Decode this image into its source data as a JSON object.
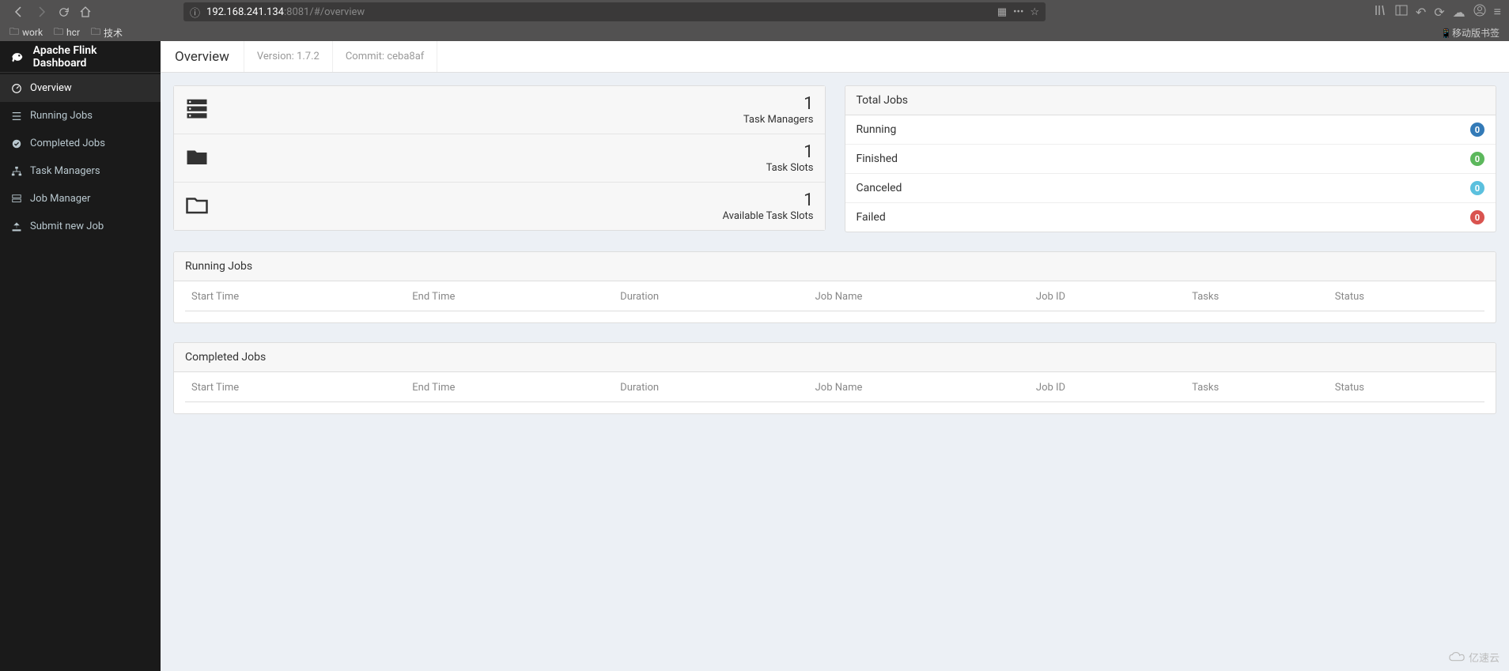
{
  "browser": {
    "url_host": "192.168.241.134",
    "url_path": ":8081/#/overview",
    "bookmarks": [
      "work",
      "hcr",
      "技术"
    ],
    "mobile_label": "移动版书签"
  },
  "sidebar": {
    "title": "Apache Flink Dashboard",
    "items": [
      {
        "label": "Overview",
        "icon": "dashboard"
      },
      {
        "label": "Running Jobs",
        "icon": "list"
      },
      {
        "label": "Completed Jobs",
        "icon": "check"
      },
      {
        "label": "Task Managers",
        "icon": "sitemap"
      },
      {
        "label": "Job Manager",
        "icon": "server"
      },
      {
        "label": "Submit new Job",
        "icon": "upload"
      }
    ]
  },
  "topbar": {
    "title": "Overview",
    "version_label": "Version:",
    "version_value": "1.7.2",
    "commit_label": "Commit:",
    "commit_value": "ceba8af"
  },
  "stats": [
    {
      "value": "1",
      "label": "Task Managers",
      "icon": "server"
    },
    {
      "value": "1",
      "label": "Task Slots",
      "icon": "folder"
    },
    {
      "value": "1",
      "label": "Available Task Slots",
      "icon": "folder-open"
    }
  ],
  "total_jobs": {
    "title": "Total Jobs",
    "rows": [
      {
        "label": "Running",
        "count": "0",
        "color": "blue"
      },
      {
        "label": "Finished",
        "count": "0",
        "color": "green"
      },
      {
        "label": "Canceled",
        "count": "0",
        "color": "lightblue"
      },
      {
        "label": "Failed",
        "count": "0",
        "color": "red"
      }
    ]
  },
  "tables": {
    "running": {
      "title": "Running Jobs"
    },
    "completed": {
      "title": "Completed Jobs"
    },
    "columns": [
      "Start Time",
      "End Time",
      "Duration",
      "Job Name",
      "Job ID",
      "Tasks",
      "Status"
    ]
  },
  "watermark": "亿速云"
}
